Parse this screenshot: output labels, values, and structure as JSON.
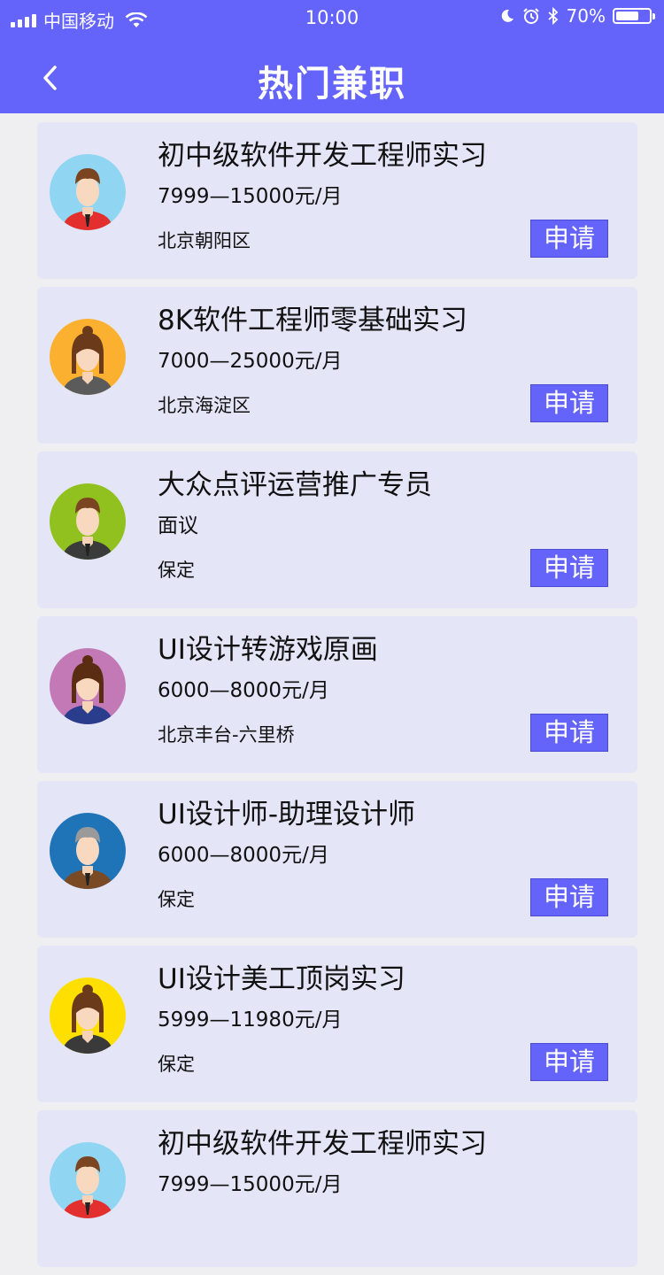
{
  "status_bar": {
    "carrier": "中国移动",
    "time": "10:00",
    "battery": "70%",
    "battery_level": 0.7
  },
  "header": {
    "title": "热门兼职",
    "back_icon": "chevron-left-icon"
  },
  "colors": {
    "brand": "#6464fb",
    "card_bg": "#e4e6f8",
    "page_bg": "#efeff2"
  },
  "jobs": [
    {
      "title": "初中级软件开发工程师实习",
      "salary": "7999—15000元/月",
      "location": "北京朝阳区",
      "apply": "申请",
      "avatar_bg": "#90d6f2",
      "avatar_shirt": "#e3302f",
      "avatar_hair": "#7a4520",
      "avatar_icon": "male-avatar-icon"
    },
    {
      "title": "8K软件工程师零基础实习",
      "salary": "7000—25000元/月",
      "location": "北京海淀区",
      "apply": "申请",
      "avatar_bg": "#fbb12f",
      "avatar_shirt": "#5b5b5b",
      "avatar_hair": "#6a3a1b",
      "avatar_icon": "female-avatar-icon"
    },
    {
      "title": "大众点评运营推广专员",
      "salary": "面议",
      "location": "保定",
      "apply": "申请",
      "avatar_bg": "#90c11e",
      "avatar_shirt": "#3b3b3b",
      "avatar_hair": "#7a4520",
      "avatar_icon": "male-avatar-icon"
    },
    {
      "title": "UI设计转游戏原画",
      "salary": "6000—8000元/月",
      "location": "北京丰台-六里桥",
      "apply": "申请",
      "avatar_bg": "#c279b6",
      "avatar_shirt": "#2a3d8c",
      "avatar_hair": "#5a2d12",
      "avatar_icon": "female-avatar-icon"
    },
    {
      "title": "UI设计师-助理设计师",
      "salary": "6000—8000元/月",
      "location": "保定",
      "apply": "申请",
      "avatar_bg": "#1f73b7",
      "avatar_shirt": "#7a4a24",
      "avatar_hair": "#9a9a9a",
      "avatar_icon": "male-avatar-icon"
    },
    {
      "title": "UI设计美工顶岗实习",
      "salary": "5999—11980元/月",
      "location": "保定",
      "apply": "申请",
      "avatar_bg": "#ffdf00",
      "avatar_shirt": "#3a3a3a",
      "avatar_hair": "#6a3a1b",
      "avatar_icon": "female-avatar-icon"
    },
    {
      "title": "初中级软件开发工程师实习",
      "salary": "7999—15000元/月",
      "location": "",
      "apply": "",
      "avatar_bg": "#90d6f2",
      "avatar_shirt": "#e3302f",
      "avatar_hair": "#7a4520",
      "avatar_icon": "male-avatar-icon"
    }
  ]
}
